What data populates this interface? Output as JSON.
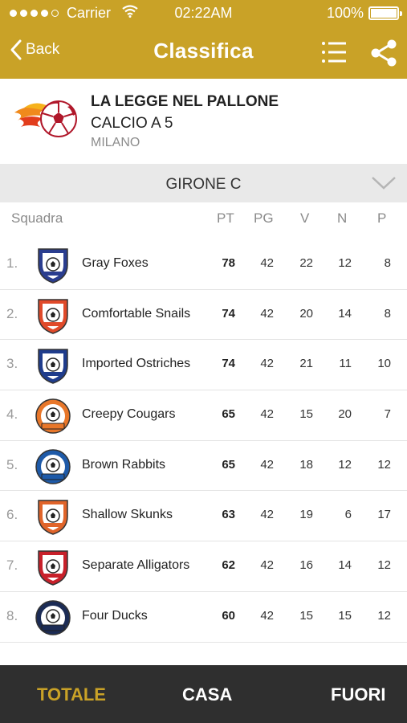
{
  "status": {
    "carrier": "Carrier",
    "time": "02:22AM",
    "battery": "100%"
  },
  "nav": {
    "back_label": "Back",
    "title": "Classifica"
  },
  "league": {
    "name": "LA LEGGE NEL PALLONE",
    "subtitle": "CALCIO A 5",
    "city": "MILANO"
  },
  "group": {
    "label": "GIRONE C"
  },
  "table": {
    "columns": {
      "team": "Squadra",
      "pt": "PT",
      "pg": "PG",
      "v": "V",
      "n": "N",
      "p": "P"
    },
    "rows": [
      {
        "pos": "1.",
        "team": "Gray Foxes",
        "pt": "78",
        "pg": "42",
        "v": "22",
        "n": "12",
        "p": "8",
        "crest": "shield-crest",
        "crest_color": "#2a3d8f"
      },
      {
        "pos": "2.",
        "team": "Comfortable Snails",
        "pt": "74",
        "pg": "42",
        "v": "20",
        "n": "14",
        "p": "8",
        "crest": "shield-crest",
        "crest_color": "#e04a2a"
      },
      {
        "pos": "3.",
        "team": "Imported Ostriches",
        "pt": "74",
        "pg": "42",
        "v": "21",
        "n": "11",
        "p": "10",
        "crest": "shield-crest",
        "crest_color": "#1f3c8c"
      },
      {
        "pos": "4.",
        "team": "Creepy Cougars",
        "pt": "65",
        "pg": "42",
        "v": "15",
        "n": "20",
        "p": "7",
        "crest": "round-crest",
        "crest_color": "#e8772a"
      },
      {
        "pos": "5.",
        "team": "Brown Rabbits",
        "pt": "65",
        "pg": "42",
        "v": "18",
        "n": "12",
        "p": "12",
        "crest": "round-crest",
        "crest_color": "#1e5aa8"
      },
      {
        "pos": "6.",
        "team": "Shallow Skunks",
        "pt": "63",
        "pg": "42",
        "v": "19",
        "n": "6",
        "p": "17",
        "crest": "shield-crest",
        "crest_color": "#e0642a"
      },
      {
        "pos": "7.",
        "team": "Separate Alligators",
        "pt": "62",
        "pg": "42",
        "v": "16",
        "n": "14",
        "p": "12",
        "crest": "shield-crest",
        "crest_color": "#c8202a"
      },
      {
        "pos": "8.",
        "team": "Four Ducks",
        "pt": "60",
        "pg": "42",
        "v": "15",
        "n": "15",
        "p": "12",
        "crest": "round-crest",
        "crest_color": "#1b2b55"
      }
    ]
  },
  "tabs": {
    "totale": "TOTALE",
    "casa": "CASA",
    "fuori": "FUORI"
  },
  "colors": {
    "accent": "#c9a227",
    "tabbar": "#2f2f2f",
    "group_bar": "#e9e9e9"
  }
}
